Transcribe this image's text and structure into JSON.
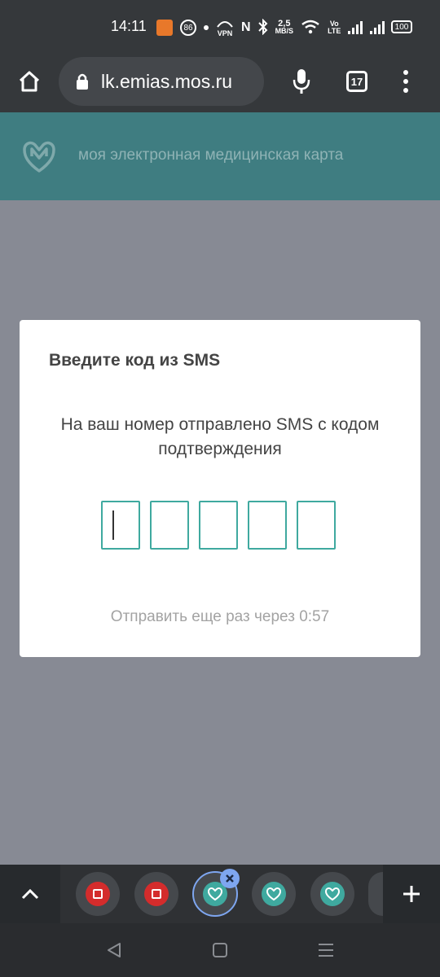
{
  "status_bar": {
    "time": "14:11",
    "notification_badge": "86",
    "vpn_label": "VPN",
    "net_speed_value": "2,5",
    "net_speed_unit": "MB/S",
    "volte_top": "Vo",
    "volte_bottom": "LTE",
    "battery": "100"
  },
  "browser": {
    "url": "lk.emias.mos.ru",
    "tabs_count": "17",
    "icons": {
      "home": "home-icon",
      "lock": "lock-icon",
      "mic": "mic-icon",
      "menu": "more-vert-icon"
    }
  },
  "site": {
    "tagline": "моя электронная медицинская карта",
    "header_color": "#3f7d81"
  },
  "modal": {
    "title": "Введите код из SMS",
    "description": "На ваш номер отправлено SMS с кодом подтверждения",
    "code_length": 5,
    "code_values": [
      "",
      "",
      "",
      "",
      ""
    ],
    "resend_text": "Отправить еще раз через 0:57",
    "accent_color": "#3fa99f"
  },
  "tab_strip": {
    "tabs": [
      {
        "favicon": "red-square-icon"
      },
      {
        "favicon": "red-square-icon"
      },
      {
        "favicon": "emias-heart-icon",
        "selected": true
      },
      {
        "favicon": "emias-heart-icon"
      },
      {
        "favicon": "emias-heart-icon"
      }
    ]
  },
  "nav_bar": {
    "icons": [
      "back-triangle-icon",
      "home-square-icon",
      "recents-lines-icon"
    ]
  }
}
